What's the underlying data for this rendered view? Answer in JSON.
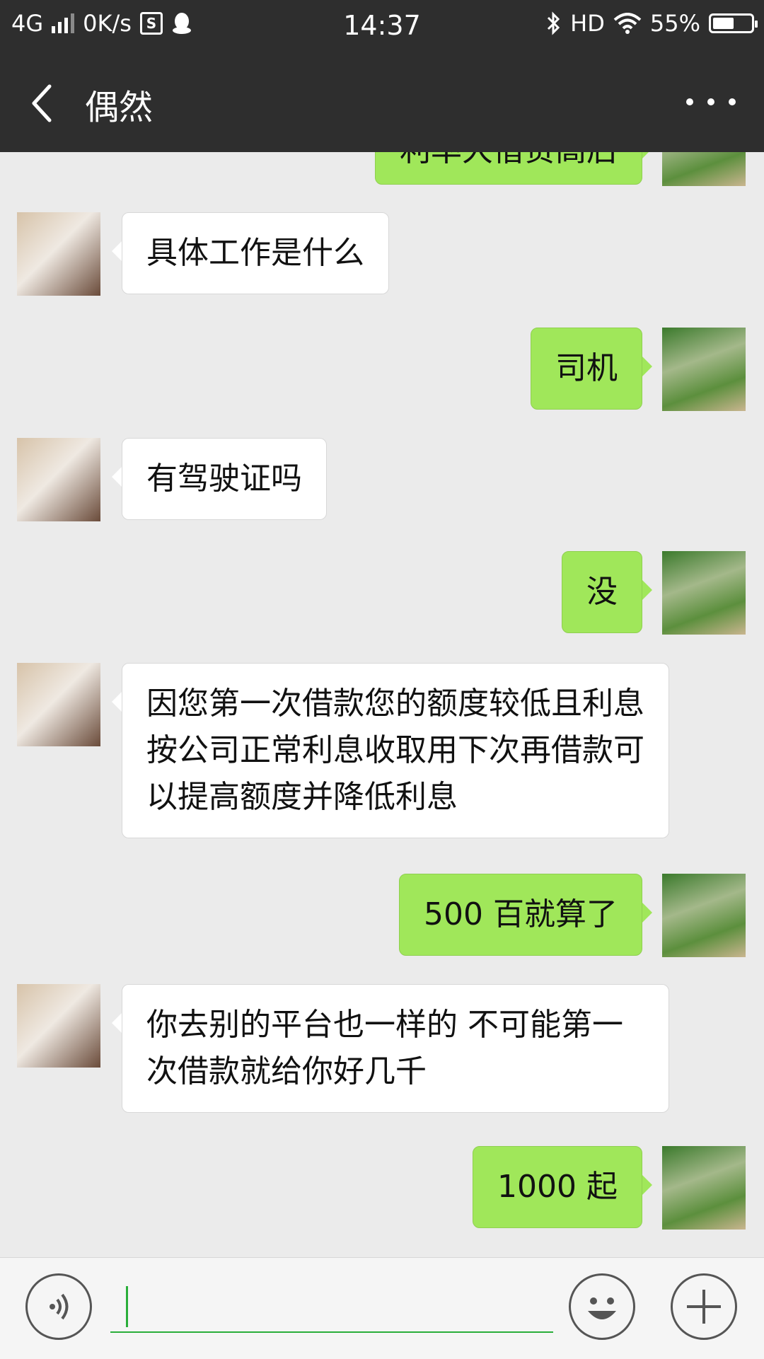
{
  "status_bar": {
    "network": "4G",
    "speed": "0K/s",
    "time": "14:37",
    "hd": "HD",
    "battery": "55%",
    "battery_level": 0.55
  },
  "header": {
    "title": "偶然",
    "back_icon": "chevron-left-icon",
    "more_icon": "more-dots-icon"
  },
  "messages": [
    {
      "side": "out",
      "text": "利率大借贷高后"
    },
    {
      "side": "in",
      "text": "具体工作是什么"
    },
    {
      "side": "out",
      "text": "司机"
    },
    {
      "side": "in",
      "text": "有驾驶证吗"
    },
    {
      "side": "out",
      "text": "没"
    },
    {
      "side": "in",
      "text": "因您第一次借款您的额度较低且利息按公司正常利息收取用下次再借款可以提高额度并降低利息"
    },
    {
      "side": "out",
      "text": "500 百就算了"
    },
    {
      "side": "in",
      "text": "你去别的平台也一样的 不可能第一次借款就给你好几千"
    },
    {
      "side": "out",
      "text": "1000 起"
    }
  ],
  "input_bar": {
    "value": "",
    "voice_icon": "voice-icon",
    "emoji_icon": "emoji-icon",
    "plus_icon": "plus-icon"
  },
  "colors": {
    "header_bg": "#2e2e2e",
    "chat_bg": "#ebebeb",
    "outgoing_bubble": "#a0e75a",
    "incoming_bubble": "#ffffff",
    "accent": "#2aae3a"
  }
}
